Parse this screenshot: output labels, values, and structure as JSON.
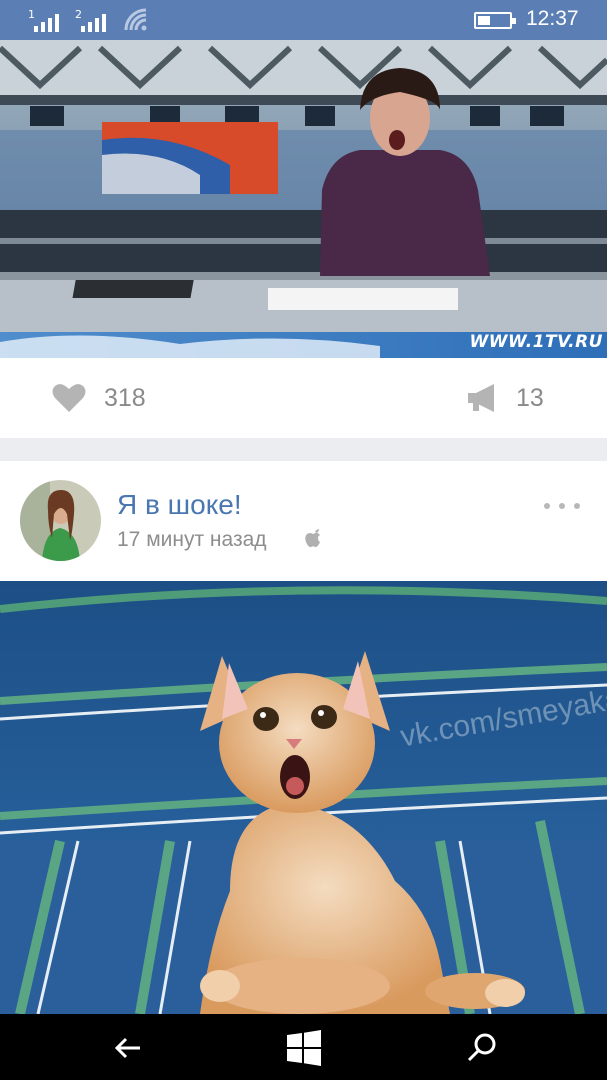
{
  "status_bar": {
    "sim1_label": "1",
    "sim2_label": "2",
    "time": "12:37",
    "icons": [
      "signal-icon",
      "signal-icon",
      "wifi-icon",
      "battery-icon"
    ]
  },
  "news_image": {
    "watermark": "WWW.1TV.RU"
  },
  "actions": {
    "likes": "318",
    "reposts": "13",
    "icons": [
      "heart-icon",
      "megaphone-icon"
    ]
  },
  "post": {
    "title": "Я в шоке!",
    "time": "17 минут назад",
    "icons": [
      "avatar",
      "apple-icon",
      "more-icon"
    ]
  },
  "cat_image": {
    "watermark": "vk.com/smeyaka"
  },
  "nav": {
    "icons": [
      "back-arrow-icon",
      "windows-start-icon",
      "search-icon"
    ]
  },
  "colors": {
    "status_bar": "#5b7fb5",
    "accent": "#4a77b0",
    "muted": "#8d8d8d",
    "background": "#ebedf0"
  }
}
